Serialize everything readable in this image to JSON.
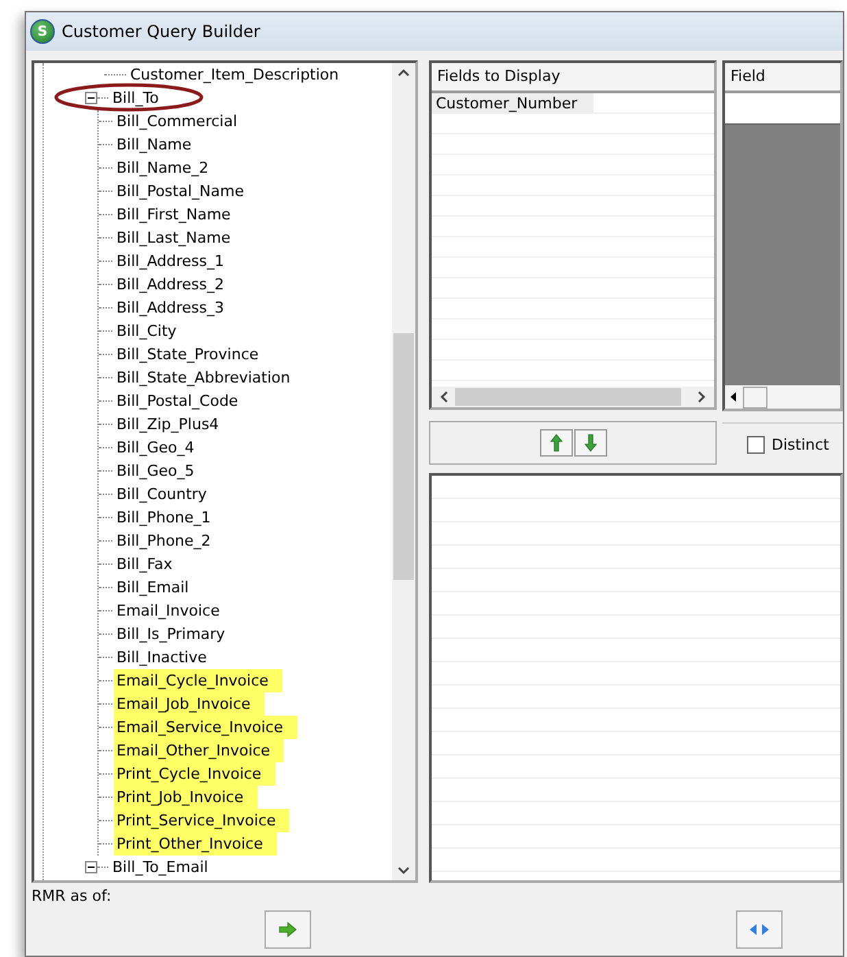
{
  "window": {
    "title": "Customer Query Builder",
    "icon_label": "S"
  },
  "tree": [
    {
      "label": "Customer_Item_Description",
      "leaf": true
    },
    {
      "label": "Bill_To",
      "expanded": true,
      "annotated": true,
      "children": [
        {
          "label": "Bill_Commercial",
          "highlighted": false
        },
        {
          "label": "Bill_Name",
          "highlighted": false
        },
        {
          "label": "Bill_Name_2",
          "highlighted": false
        },
        {
          "label": "Bill_Postal_Name",
          "highlighted": false
        },
        {
          "label": "Bill_First_Name",
          "highlighted": false
        },
        {
          "label": "Bill_Last_Name",
          "highlighted": false
        },
        {
          "label": "Bill_Address_1",
          "highlighted": false
        },
        {
          "label": "Bill_Address_2",
          "highlighted": false
        },
        {
          "label": "Bill_Address_3",
          "highlighted": false
        },
        {
          "label": "Bill_City",
          "highlighted": false
        },
        {
          "label": "Bill_State_Province",
          "highlighted": false
        },
        {
          "label": "Bill_State_Abbreviation",
          "highlighted": false
        },
        {
          "label": "Bill_Postal_Code",
          "highlighted": false
        },
        {
          "label": "Bill_Zip_Plus4",
          "highlighted": false
        },
        {
          "label": "Bill_Geo_4",
          "highlighted": false
        },
        {
          "label": "Bill_Geo_5",
          "highlighted": false
        },
        {
          "label": "Bill_Country",
          "highlighted": false
        },
        {
          "label": "Bill_Phone_1",
          "highlighted": false
        },
        {
          "label": "Bill_Phone_2",
          "highlighted": false
        },
        {
          "label": "Bill_Fax",
          "highlighted": false
        },
        {
          "label": "Bill_Email",
          "highlighted": false
        },
        {
          "label": "Email_Invoice",
          "highlighted": false
        },
        {
          "label": "Bill_Is_Primary",
          "highlighted": false
        },
        {
          "label": "Bill_Inactive",
          "highlighted": false
        },
        {
          "label": "Email_Cycle_Invoice",
          "highlighted": true
        },
        {
          "label": "Email_Job_Invoice",
          "highlighted": true
        },
        {
          "label": "Email_Service_Invoice",
          "highlighted": true
        },
        {
          "label": "Email_Other_Invoice",
          "highlighted": true
        },
        {
          "label": "Print_Cycle_Invoice",
          "highlighted": true
        },
        {
          "label": "Print_Job_Invoice",
          "highlighted": true
        },
        {
          "label": "Print_Service_Invoice",
          "highlighted": true
        },
        {
          "label": "Print_Other_Invoice",
          "highlighted": true
        }
      ]
    },
    {
      "label": "Bill_To_Email",
      "expanded": true,
      "annotated": false
    }
  ],
  "fields_to_display": {
    "header": "Fields to Display",
    "rows": [
      "Customer_Number"
    ]
  },
  "criteria": {
    "header": "Field"
  },
  "distinct": {
    "label": "Distinct",
    "checked": false
  },
  "status_bar": {
    "text": "RMR as of:"
  }
}
